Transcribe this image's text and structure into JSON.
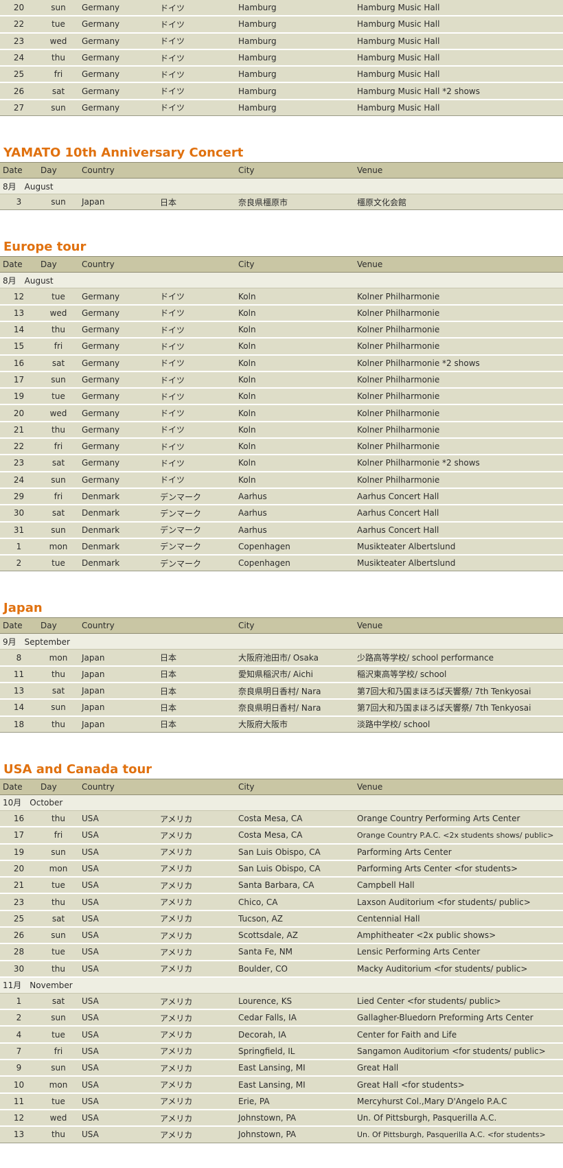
{
  "header_labels": {
    "date": "Date",
    "day": "Day",
    "country": "Country",
    "city": "City",
    "venue": "Venue"
  },
  "sections": [
    {
      "title": "",
      "show_header": false,
      "groups": [
        {
          "month": "",
          "rows": [
            [
              "20",
              "sun",
              "Germany",
              "ドイツ",
              "Hamburg",
              "Hamburg Music Hall"
            ],
            [
              "22",
              "tue",
              "Germany",
              "ドイツ",
              "Hamburg",
              "Hamburg Music Hall"
            ],
            [
              "23",
              "wed",
              "Germany",
              "ドイツ",
              "Hamburg",
              "Hamburg Music Hall"
            ],
            [
              "24",
              "thu",
              "Germany",
              "ドイツ",
              "Hamburg",
              "Hamburg Music Hall"
            ],
            [
              "25",
              "fri",
              "Germany",
              "ドイツ",
              "Hamburg",
              "Hamburg Music Hall"
            ],
            [
              "26",
              "sat",
              "Germany",
              "ドイツ",
              "Hamburg",
              "Hamburg Music Hall  *2 shows"
            ],
            [
              "27",
              "sun",
              "Germany",
              "ドイツ",
              "Hamburg",
              "Hamburg Music Hall"
            ]
          ]
        }
      ]
    },
    {
      "title": "YAMATO 10th Anniversary Concert",
      "show_header": true,
      "groups": [
        {
          "month": "8月　August",
          "rows": [
            [
              "3",
              "sun",
              "Japan",
              "日本",
              "奈良県橿原市",
              "橿原文化会館"
            ]
          ]
        }
      ]
    },
    {
      "title": "Europe tour",
      "show_header": true,
      "groups": [
        {
          "month": "8月　August",
          "rows": [
            [
              "12",
              "tue",
              "Germany",
              "ドイツ",
              "Koln",
              "Kolner Philharmonie"
            ],
            [
              "13",
              "wed",
              "Germany",
              "ドイツ",
              "Koln",
              "Kolner Philharmonie"
            ],
            [
              "14",
              "thu",
              "Germany",
              "ドイツ",
              "Koln",
              "Kolner Philharmonie"
            ],
            [
              "15",
              "fri",
              "Germany",
              "ドイツ",
              "Koln",
              "Kolner Philharmonie"
            ],
            [
              "16",
              "sat",
              "Germany",
              "ドイツ",
              "Koln",
              "Kolner Philharmonie  *2 shows"
            ],
            [
              "17",
              "sun",
              "Germany",
              "ドイツ",
              "Koln",
              "Kolner Philharmonie"
            ],
            [
              "19",
              "tue",
              "Germany",
              "ドイツ",
              "Koln",
              "Kolner Philharmonie"
            ],
            [
              "20",
              "wed",
              "Germany",
              "ドイツ",
              "Koln",
              "Kolner Philharmonie"
            ],
            [
              "21",
              "thu",
              "Germany",
              "ドイツ",
              "Koln",
              "Kolner Philharmonie"
            ],
            [
              "22",
              "fri",
              "Germany",
              "ドイツ",
              "Koln",
              "Kolner Philharmonie"
            ],
            [
              "23",
              "sat",
              "Germany",
              "ドイツ",
              "Koln",
              "Kolner Philharmonie  *2 shows"
            ],
            [
              "24",
              "sun",
              "Germany",
              "ドイツ",
              "Koln",
              "Kolner Philharmonie"
            ],
            [
              "29",
              "fri",
              "Denmark",
              "デンマーク",
              "Aarhus",
              "Aarhus Concert Hall"
            ],
            [
              "30",
              "sat",
              "Denmark",
              "デンマーク",
              "Aarhus",
              "Aarhus Concert Hall"
            ],
            [
              "31",
              "sun",
              "Denmark",
              "デンマーク",
              "Aarhus",
              "Aarhus Concert Hall"
            ],
            [
              "1",
              "mon",
              "Denmark",
              "デンマーク",
              "Copenhagen",
              "Musikteater Albertslund"
            ],
            [
              "2",
              "tue",
              "Denmark",
              "デンマーク",
              "Copenhagen",
              "Musikteater Albertslund"
            ]
          ]
        }
      ]
    },
    {
      "title": "Japan",
      "show_header": true,
      "groups": [
        {
          "month": "9月　September",
          "rows": [
            [
              "8",
              "mon",
              "Japan",
              "日本",
              "大阪府池田市/ Osaka",
              "少路高等学校/ school performance"
            ],
            [
              "11",
              "thu",
              "Japan",
              "日本",
              "愛知県稲沢市/ Aichi",
              "稲沢東高等学校/ school"
            ],
            [
              "13",
              "sat",
              "Japan",
              "日本",
              "奈良県明日香村/ Nara",
              "第7回大和乃国まほろば天響祭/ 7th Tenkyosai"
            ],
            [
              "14",
              "sun",
              "Japan",
              "日本",
              "奈良県明日香村/ Nara",
              "第7回大和乃国まほろば天響祭/ 7th Tenkyosai"
            ],
            [
              "18",
              "thu",
              "Japan",
              "日本",
              "大阪府大阪市",
              "淡路中学校/ school"
            ]
          ]
        }
      ]
    },
    {
      "title": "USA and Canada tour",
      "show_header": true,
      "groups": [
        {
          "month": "10月　October",
          "rows": [
            [
              "16",
              "thu",
              "USA",
              "アメリカ",
              "Costa Mesa, CA",
              "Orange Country Performing Arts Center"
            ],
            [
              "17",
              "fri",
              "USA",
              "アメリカ",
              "Costa Mesa, CA",
              "Orange Country P.A.C. <2x students shows/ public>"
            ],
            [
              "19",
              "sun",
              "USA",
              "アメリカ",
              "San Luis Obispo, CA",
              "Parforming Arts Center"
            ],
            [
              "20",
              "mon",
              "USA",
              "アメリカ",
              "San Luis Obispo, CA",
              "Parforming Arts Center <for students>"
            ],
            [
              "21",
              "tue",
              "USA",
              "アメリカ",
              "Santa Barbara, CA",
              "Campbell Hall"
            ],
            [
              "23",
              "thu",
              "USA",
              "アメリカ",
              "Chico, CA",
              "Laxson Auditorium <for students/ public>"
            ],
            [
              "25",
              "sat",
              "USA",
              "アメリカ",
              "Tucson, AZ",
              "Centennial Hall"
            ],
            [
              "26",
              "sun",
              "USA",
              "アメリカ",
              "Scottsdale, AZ",
              "Amphitheater <2x public shows>"
            ],
            [
              "28",
              "tue",
              "USA",
              "アメリカ",
              "Santa Fe, NM",
              "Lensic Performing Arts Center"
            ],
            [
              "30",
              "thu",
              "USA",
              "アメリカ",
              "Boulder, CO",
              "Macky Auditorium <for students/ public>"
            ]
          ]
        },
        {
          "month": "11月　November",
          "rows": [
            [
              "1",
              "sat",
              "USA",
              "アメリカ",
              "Lourence, KS",
              "Lied Center <for students/ public>"
            ],
            [
              "2",
              "sun",
              "USA",
              "アメリカ",
              "Cedar Falls, IA",
              "Gallagher-Bluedorn Preforming Arts Center"
            ],
            [
              "4",
              "tue",
              "USA",
              "アメリカ",
              "Decorah, IA",
              "Center for Faith and Life"
            ],
            [
              "7",
              "fri",
              "USA",
              "アメリカ",
              "Springfield, IL",
              "Sangamon Auditorium <for students/ public>"
            ],
            [
              "9",
              "sun",
              "USA",
              "アメリカ",
              "East Lansing, MI",
              "Great Hall"
            ],
            [
              "10",
              "mon",
              "USA",
              "アメリカ",
              "East Lansing, MI",
              "Great Hall <for students>"
            ],
            [
              "11",
              "tue",
              "USA",
              "アメリカ",
              "Erie, PA",
              "Mercyhurst Col.,Mary D'Angelo P.A.C"
            ],
            [
              "12",
              "wed",
              "USA",
              "アメリカ",
              "Johnstown, PA",
              "Un. Of Pittsburgh, Pasquerilla A.C."
            ],
            [
              "13",
              "thu",
              "USA",
              "アメリカ",
              "Johnstown, PA",
              "Un. Of Pittsburgh, Pasquerilla A.C. <for students>"
            ]
          ]
        }
      ]
    }
  ]
}
